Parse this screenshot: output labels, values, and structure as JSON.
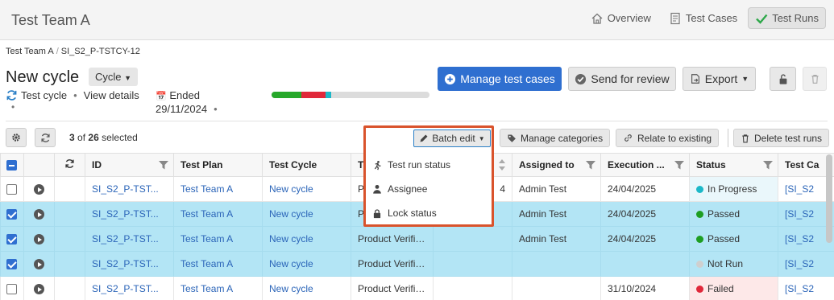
{
  "app": {
    "title": "Test Team A"
  },
  "nav": {
    "overview": "Overview",
    "test_cases": "Test Cases",
    "test_runs": "Test Runs"
  },
  "breadcrumb": {
    "item1": "Test Team A",
    "item2": "SI_S2_P-TSTCY-12"
  },
  "cycle": {
    "title": "New cycle",
    "type_label": "Cycle",
    "kind": "Test cycle",
    "details_link": "View details",
    "ended_label": "Ended",
    "ended_date": "29/11/2024",
    "progress": [
      {
        "fraction": 0.19,
        "color": "#27a82a"
      },
      {
        "fraction": 0.15,
        "color": "#e0283a"
      },
      {
        "fraction": 0.04,
        "color": "#1cb8c8"
      }
    ]
  },
  "actions": {
    "manage": "Manage test cases",
    "review": "Send for review",
    "export": "Export"
  },
  "toolbar": {
    "selected_count": "3",
    "of": "of",
    "total": "26",
    "selected_label": "selected",
    "manage_categories": "Manage categories",
    "relate": "Relate to existing",
    "delete": "Delete test runs"
  },
  "batch": {
    "button": "Batch edit",
    "items": [
      "Test run status",
      "Assignee",
      "Lock status"
    ]
  },
  "table": {
    "headers": {
      "id": "ID",
      "plan": "Test Plan",
      "cycle": "Test Cycle",
      "case": "Te",
      "assigned": "Assigned to",
      "exec": "Execution ...",
      "status": "Status",
      "cat": "Test Ca"
    },
    "rows": [
      {
        "selected": false,
        "id": "SI_S2_P-TST...",
        "plan": "Test Team A",
        "cycle": "New cycle",
        "case": "P",
        "num": "4",
        "assigned": "Admin Test",
        "exec": "24/04/2025",
        "status": "In Progress",
        "status_color": "#1cb8c8",
        "cat": "[SI_S2"
      },
      {
        "selected": true,
        "id": "SI_S2_P-TST...",
        "plan": "Test Team A",
        "cycle": "New cycle",
        "case": "Pr",
        "num": "",
        "assigned": "Admin Test",
        "exec": "24/04/2025",
        "status": "Passed",
        "status_color": "#1e9e22",
        "cat": "[SI_S2"
      },
      {
        "selected": true,
        "id": "SI_S2_P-TST...",
        "plan": "Test Team A",
        "cycle": "New cycle",
        "case": "Product Verific...",
        "num": "",
        "assigned": "Admin Test",
        "exec": "24/04/2025",
        "status": "Passed",
        "status_color": "#1e9e22",
        "cat": "[SI_S2"
      },
      {
        "selected": true,
        "id": "SI_S2_P-TST...",
        "plan": "Test Team A",
        "cycle": "New cycle",
        "case": "Product Verific...",
        "num": "",
        "assigned": "",
        "exec": "",
        "status": "Not Run",
        "status_color": "#cfcfcf",
        "cat": "[SI_S2"
      },
      {
        "selected": false,
        "id": "SI_S2_P-TST...",
        "plan": "Test Team A",
        "cycle": "New cycle",
        "case": "Product Verific...",
        "num": "",
        "assigned": "",
        "exec": "31/10/2024",
        "status": "Failed",
        "status_color": "#e0283a",
        "cat": "[SI_S2"
      }
    ]
  }
}
